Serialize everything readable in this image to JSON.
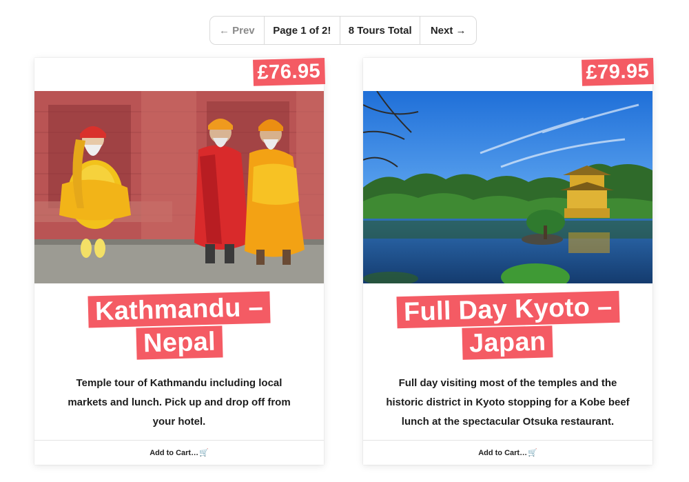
{
  "pagination": {
    "prev_label": "← Prev",
    "page_label": "Page 1 of 2!",
    "total_label": "8 Tours Total",
    "next_label": "Next →"
  },
  "tours": [
    {
      "price": "£76.95",
      "title_line1": "Kathmandu –",
      "title_line2": "Nepal",
      "description": "Temple tour of Kathmandu including local markets and lunch. Pick up and drop off from your hotel.",
      "cart_label": "Add to Cart…",
      "cart_icon": "cart-icon"
    },
    {
      "price": "£79.95",
      "title_line1": "Full Day Kyoto –",
      "title_line2": "Japan",
      "description": "Full day visiting most of the temples and the historic district in Kyoto stopping for a Kobe beef lunch at the spectacular Otsuka restaurant.",
      "cart_label": "Add to Cart…",
      "cart_icon": "cart-icon"
    }
  ],
  "colors": {
    "accent": "#f45b64",
    "text": "#222222",
    "muted": "#8a8a8a"
  }
}
